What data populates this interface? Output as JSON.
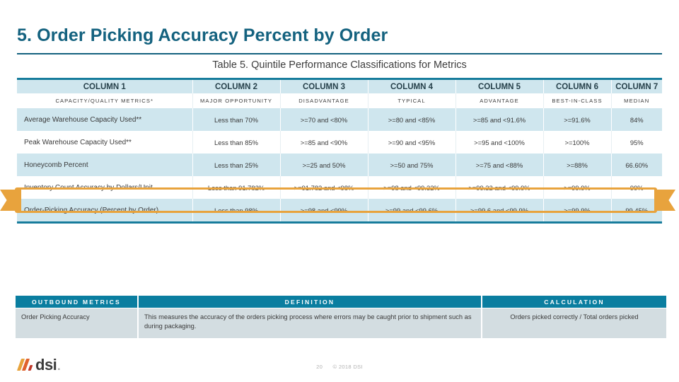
{
  "slide": {
    "title": "5. Order Picking Accuracy Percent by Order",
    "accent_color": "#14627f",
    "highlight_color": "#e8a33d",
    "band_color": "#cfe6ee",
    "header_bar_color": "#0a7ea0"
  },
  "table_caption": "Table 5. Quintile Performance Classifications for Metrics",
  "quintile_table": {
    "headers": [
      "COLUMN 1",
      "COLUMN 2",
      "COLUMN 3",
      "COLUMN 4",
      "COLUMN 5",
      "COLUMN 6",
      "COLUMN 7"
    ],
    "subheaders": [
      "CAPACITY/QUALITY METRICS*",
      "MAJOR OPPORTUNITY",
      "DISADVANTAGE",
      "TYPICAL",
      "ADVANTAGE",
      "BEST-IN-CLASS",
      "MEDIAN"
    ],
    "rows": [
      {
        "highlighted": false,
        "shaded": true,
        "cells": [
          "Average Warehouse Capacity Used**",
          "Less than 70%",
          ">=70 and <80%",
          ">=80 and <85%",
          ">=85 and <91.6%",
          ">=91.6%",
          "84%"
        ]
      },
      {
        "highlighted": false,
        "shaded": false,
        "cells": [
          "Peak Warehouse Capacity Used**",
          "Less than 85%",
          ">=85 and <90%",
          ">=90 and <95%",
          ">=95 and <100%",
          ">=100%",
          "95%"
        ]
      },
      {
        "highlighted": false,
        "shaded": true,
        "cells": [
          "Honeycomb Percent",
          "Less than 25%",
          ">=25 and 50%",
          ">=50 and 75%",
          ">=75 and <88%",
          ">=88%",
          "66.60%"
        ]
      },
      {
        "highlighted": false,
        "shaded": false,
        "cells": [
          "Inventory Count Accuracy by Dollars/Unit",
          "Less than 91.782%",
          ">=91.782 and <98%",
          ">=98 and <99.32%",
          ">=99.32 and <99.9%",
          ">=99.9%",
          "99%"
        ]
      },
      {
        "highlighted": true,
        "shaded": true,
        "cells": [
          "Order-Picking Accuracy (Percent by Order)",
          "Less than 98%",
          ">=98 and <99%",
          ">=99 and <99.6%",
          ">=99.6 and <99.9%",
          ">=99.9%",
          "99.45%"
        ]
      }
    ]
  },
  "definition_table": {
    "headers": [
      "OUTBOUND METRICS",
      "DEFINITION",
      "CALCULATION"
    ],
    "rows": [
      {
        "metric": "Order Picking Accuracy",
        "definition": "This measures the accuracy of the orders picking process where errors may be caught prior to shipment such as during packaging.",
        "calculation": "Orders picked correctly / Total orders picked"
      }
    ]
  },
  "footer": {
    "logo_text": "dsi",
    "logo_dot": ".",
    "page_number": "20",
    "copyright": "© 2018 DSI"
  }
}
